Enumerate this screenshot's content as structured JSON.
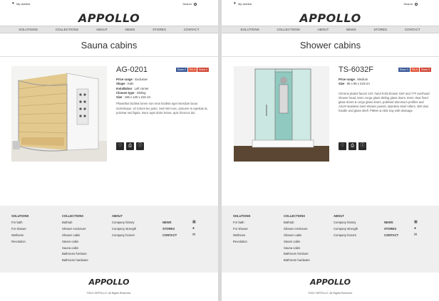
{
  "header": {
    "wishlist": "My wishlist",
    "search": "Search",
    "logo": "APPOLLO"
  },
  "nav": [
    "SOLUTIONS",
    "COLLECTIONS",
    "ABOUT",
    "NEWS",
    "STORES",
    "CONTACT"
  ],
  "share": {
    "fb": "Share 0",
    "pin": "Pin it",
    "plus": "Share 0"
  },
  "pages": {
    "left": {
      "title": "Sauna cabins",
      "product": {
        "code": "AG-0201",
        "specs": [
          {
            "label": "Price range",
            "value": "Exclusive"
          },
          {
            "label": "Shape",
            "value": "Kidn"
          },
          {
            "label": "Installation",
            "value": "Left corner"
          },
          {
            "label": "Closure type",
            "value": "Sliding"
          },
          {
            "label": "Size",
            "value": "165 x 120 x 215 cm"
          }
        ],
        "desc": "Phasellus facilisis lorem non eros facilisis eget interdum lacus scelerisque. Ut rutrum leo justo. Sed nisl nunc, posuere in egestas at, pulvinar sed ligula. Nunc eget dolor lectus, quis rhoncus dui."
      }
    },
    "right": {
      "title": "Shower cabins",
      "product": {
        "code": "TS-6032F",
        "specs": [
          {
            "label": "Price range",
            "value": "Medium"
          },
          {
            "label": "Size",
            "value": "95 x 95 x 219 cm"
          }
        ],
        "desc": "Chrome plated faucet 12#, hand hold shower SS# and 77# overhead shower head, 5mm cergo glass sliding glass doors, 5mm clear fixed glass doors & cergo glass doors, polished aluminum profiles and ASU# stainless steel shower panels, stainless steel rollers, 36# door handle and glass shelf, PMMA & ABS tray with drainage."
      }
    }
  },
  "footer": {
    "solutions": {
      "title": "SOLUTIONS",
      "items": [
        "For bath",
        "For shower",
        "Wellness",
        "Revolution"
      ]
    },
    "collections": {
      "title": "COLLECTIONS",
      "items": [
        "Bathtub",
        "Shower enclosure",
        "Shower cabin",
        "Steam cabin",
        "Sauna cabin",
        "Bathroom furniture",
        "Bathroom hardware"
      ]
    },
    "about": {
      "title": "ABOUT",
      "items": [
        "Company history",
        "Company strength",
        "Company honors"
      ]
    },
    "links": [
      "NEWS",
      "STORES",
      "CONTACT"
    ],
    "logo": "APPOLLO",
    "copyright": "©2017 APPOLLO. All Rights Reserved."
  },
  "icons": {
    "heart": "heart-icon",
    "search": "search-icon",
    "wishlist_add": "heart-icon",
    "print": "print-icon",
    "info": "info-icon",
    "news": "calendar-icon",
    "stores": "map-pin-icon",
    "contact": "envelope-icon"
  }
}
